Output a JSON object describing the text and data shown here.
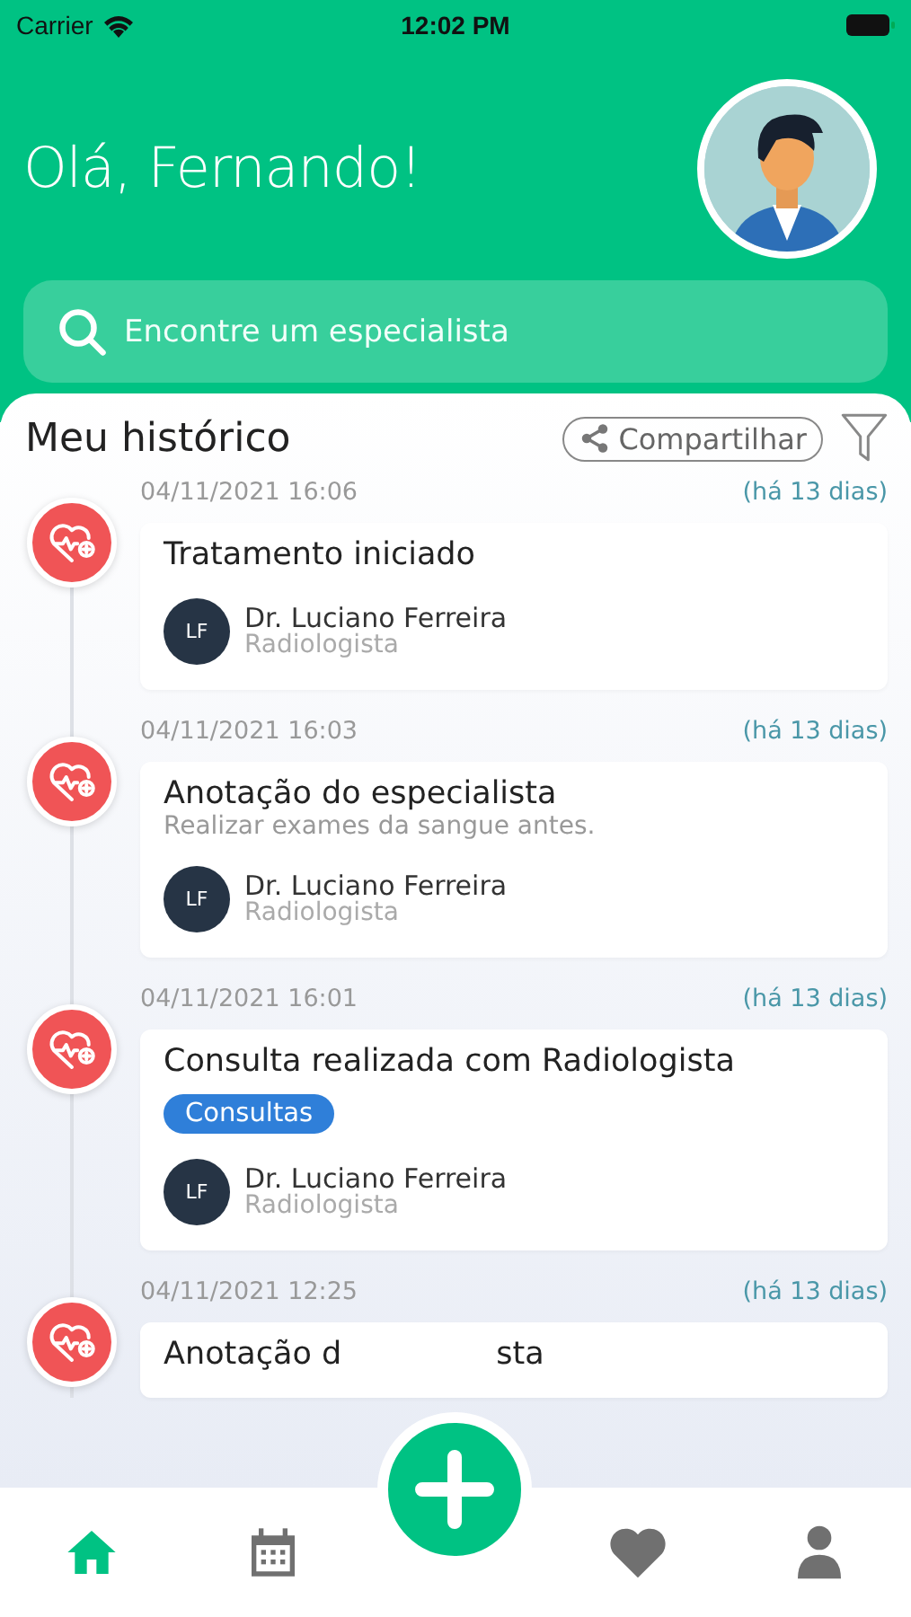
{
  "status_bar": {
    "carrier": "Carrier",
    "time": "12:02 PM"
  },
  "greeting": "Olá, Fernando!",
  "search": {
    "placeholder": "Encontre um especialista"
  },
  "history": {
    "title": "Meu histórico",
    "share_label": "Compartilhar",
    "entries": [
      {
        "date": "04/11/2021 16:06",
        "ago": "(há 13 dias)",
        "title": "Tratamento iniciado",
        "doctor": {
          "initials": "LF",
          "name": "Dr. Luciano Ferreira",
          "role": "Radiologista"
        }
      },
      {
        "date": "04/11/2021 16:03",
        "ago": "(há 13 dias)",
        "title": "Anotação do especialista",
        "note": "Realizar exames da sangue antes.",
        "doctor": {
          "initials": "LF",
          "name": "Dr. Luciano Ferreira",
          "role": "Radiologista"
        }
      },
      {
        "date": "04/11/2021 16:01",
        "ago": "(há 13 dias)",
        "title": "Consulta realizada com Radiologista",
        "tag": "Consultas",
        "doctor": {
          "initials": "LF",
          "name": "Dr. Luciano Ferreira",
          "role": "Radiologista"
        }
      },
      {
        "date": "04/11/2021 12:25",
        "ago": "(há 13 dias)",
        "title_parts": [
          "Anotação d",
          "sta"
        ]
      }
    ]
  },
  "tabs": [
    {
      "kind": "home",
      "selected": true
    },
    {
      "kind": "calendar",
      "selected": false
    },
    {
      "kind": "add"
    },
    {
      "kind": "favorites",
      "selected": false
    },
    {
      "kind": "profile",
      "selected": false
    }
  ]
}
